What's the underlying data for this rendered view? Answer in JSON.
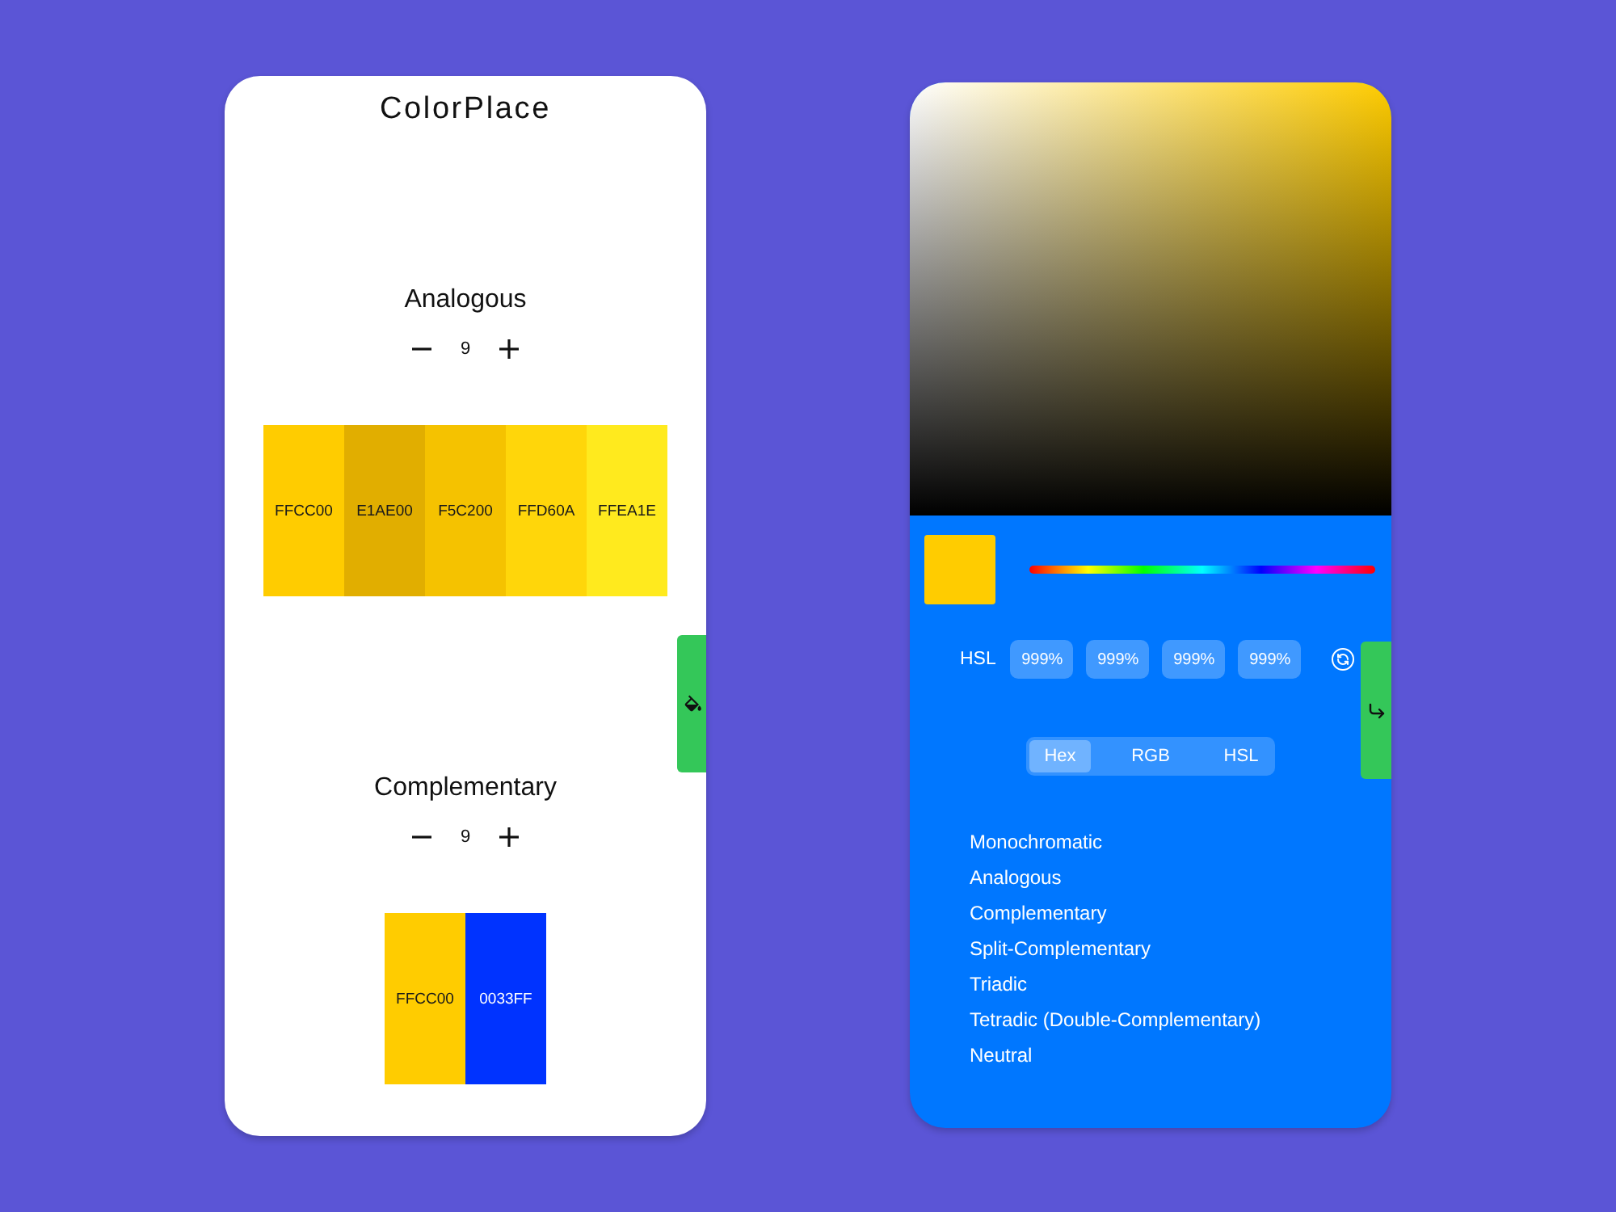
{
  "left_panel": {
    "title": "ColorPlace",
    "schemes": [
      {
        "name": "Analogous",
        "count": "9",
        "swatches": [
          {
            "label": "FFCC00",
            "color": "#ffcc00"
          },
          {
            "label": "E1AE00",
            "color": "#e1ae00"
          },
          {
            "label": "F5C200",
            "color": "#f5c200"
          },
          {
            "label": "FFD60A",
            "color": "#ffd60a"
          },
          {
            "label": "FFEA1E",
            "color": "#ffea1e"
          }
        ]
      },
      {
        "name": "Complementary",
        "count": "9",
        "swatches": [
          {
            "label": "FFCC00",
            "color": "#ffcc00"
          },
          {
            "label": "0033FF",
            "color": "#0033ff"
          }
        ]
      }
    ]
  },
  "right_panel": {
    "picker": {
      "color": "#ffcc00"
    },
    "selected_swatch": {
      "color": "#ffcc00"
    },
    "values": {
      "label": "HSL",
      "inputs": [
        {
          "value": "999%"
        },
        {
          "value": "999%"
        },
        {
          "value": "999%"
        },
        {
          "value": "999%"
        }
      ]
    },
    "formats": [
      {
        "label": "Hex",
        "selected": true
      },
      {
        "label": "RGB",
        "selected": false
      },
      {
        "label": "HSL",
        "selected": false
      }
    ],
    "scheme_menu": [
      "Monochromatic",
      "Analogous",
      "Complementary",
      "Split-Complementary",
      "Triadic",
      "Tetradic (Double-Complementary)",
      "Neutral"
    ]
  }
}
